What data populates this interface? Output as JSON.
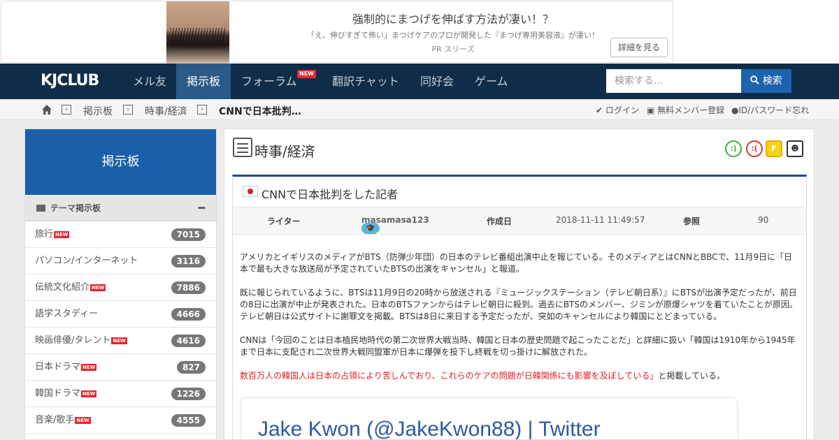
{
  "ad": {
    "title": "強制的にまつげを伸ばす方法が凄い！？",
    "subtitle": "「え、伸びすぎて怖い」まつげケアのプロが開発した『まつげ専用美容液』が凄い！",
    "sponsor": "PR スリーズ",
    "button": "詳細を見る"
  },
  "nav": {
    "logo": "KJCLUB",
    "items": [
      "メル友",
      "掲示板",
      "フォーラム",
      "翻訳チャット",
      "同好会",
      "ゲーム"
    ],
    "new_badge": "NEW",
    "search_placeholder": "検索する...",
    "search_button": "検索"
  },
  "breadcrumb": {
    "items": [
      "掲示板",
      "時事/経済",
      "CNNで日本批判…"
    ]
  },
  "account": {
    "login": "ログイン",
    "register": "無料メンバー登録",
    "forgot": "ID/パスワード忘れ"
  },
  "sidebar": {
    "header": "掲示板",
    "section": "テーマ掲示板",
    "items": [
      {
        "label": "旅行",
        "new": true,
        "count": "7015"
      },
      {
        "label": "パソコン/インターネット",
        "new": false,
        "count": "3116"
      },
      {
        "label": "伝統文化紹介",
        "new": true,
        "count": "7886"
      },
      {
        "label": "語学スタディー",
        "new": false,
        "count": "4666"
      },
      {
        "label": "映画俳優/タレント",
        "new": true,
        "count": "4616"
      },
      {
        "label": "日本ドラマ",
        "new": true,
        "count": "827"
      },
      {
        "label": "韓国ドラマ",
        "new": true,
        "count": "1226"
      },
      {
        "label": "音楽/歌手",
        "new": true,
        "count": "4555"
      }
    ]
  },
  "board": {
    "title": "時事/経済"
  },
  "post": {
    "title": "CNNで日本批判をした記者",
    "writer_label": "ライター",
    "level": "2",
    "author": "masamasa123",
    "date_label": "作成日",
    "date": "2018-11-11 11:49:57",
    "views_label": "参照",
    "views": "90",
    "para1": "アメリカとイギリスのメディアがBTS（防弾少年団）の日本のテレビ番組出演中止を報じている。そのメディアとはCNNとBBCで、11月9日に「日本で最も大きな放送局が予定されていたBTSの出演をキャンセル」と報道。",
    "para2": "既に報じられているように、BTSは11月9日の20時から放送される『ミュージックステーション（テレビ朝日系）』にBTSが出演予定だったが、前日の8日に出演が中止が発表された。日本のBTSファンからはテレビ朝日に殺到。過去にBTSのメンバー、ジミンが原爆シャツを着ていたことが原因。テレビ朝日は公式サイトに謝罪文を掲載。BTSは8日に来日する予定だったが、突如のキャンセルにより韓国にとどまっている。",
    "para3": "CNNは「今回のことは日本植民地時代の第二次世界大戦当時、韓国と日本の歴史問題で起こったことだ」と詳細に扱い「韓国は1910年から1945年まで日本に支配され二次世界大戦同盟軍が日本に爆弾を投下し終戦を切っ掛けに解放された。",
    "para4_red": "数百万人の韓国人は日本の占領により苦しんでおり、これらのケアの問題が日韓関係にも影響を及ぼしている」",
    "para4_tail": "と掲載している。",
    "embed_title": "Jake Kwon (@JakeKwon88) | Twitter"
  }
}
